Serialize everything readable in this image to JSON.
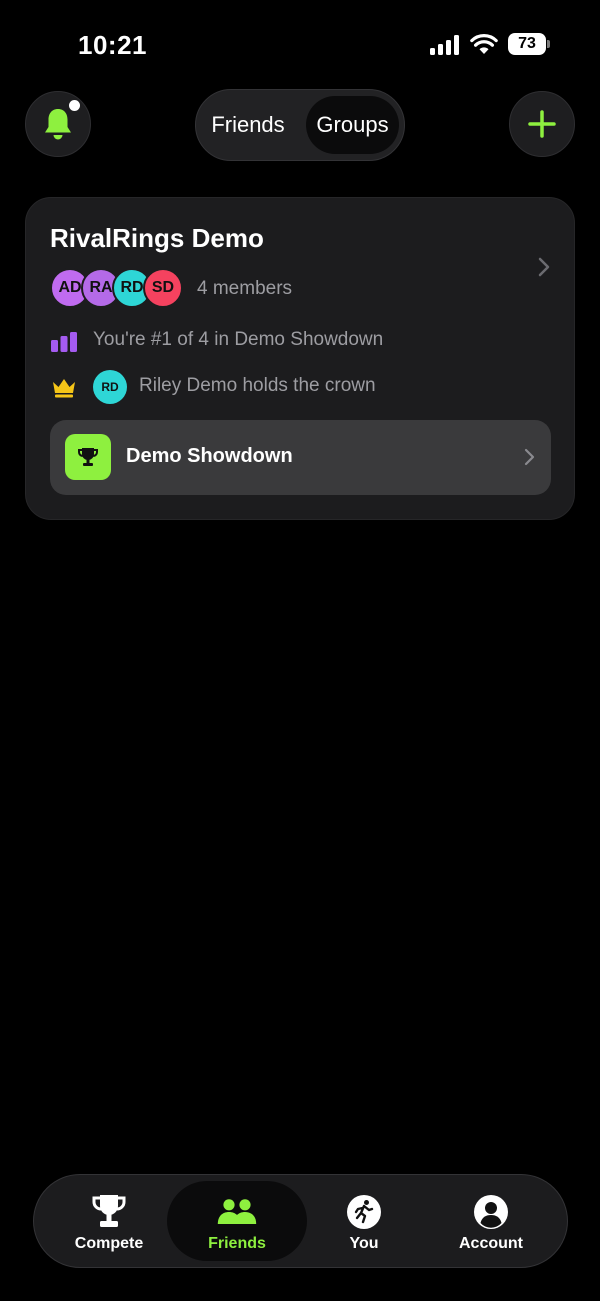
{
  "status_bar": {
    "time": "10:21",
    "battery": "73"
  },
  "header": {
    "segments": [
      {
        "label": "Friends",
        "selected": false
      },
      {
        "label": "Groups",
        "selected": true
      }
    ],
    "bell_has_notification": true
  },
  "group_card": {
    "title": "RivalRings Demo",
    "avatars": [
      {
        "initials": "AD",
        "color": "#c06bf0"
      },
      {
        "initials": "RA",
        "color": "#b46ae8"
      },
      {
        "initials": "RD",
        "color": "#2ed6d6"
      },
      {
        "initials": "SD",
        "color": "#f5425f"
      }
    ],
    "members": "4 members",
    "rank_text": "You're #1 of 4 in Demo Showdown",
    "crown_avatar": "RD",
    "crown_text": "Riley Demo holds the crown",
    "challenge": {
      "name": "Demo Showdown"
    }
  },
  "tab_bar": {
    "tabs": [
      {
        "label": "Compete",
        "icon": "trophy-icon",
        "selected": false
      },
      {
        "label": "Friends",
        "icon": "friends-icon",
        "selected": true
      },
      {
        "label": "You",
        "icon": "runner-icon",
        "selected": false
      },
      {
        "label": "Account",
        "icon": "account-icon",
        "selected": false
      }
    ]
  },
  "colors": {
    "accent": "#8ef03f",
    "background": "#000000",
    "card": "#1c1c1e",
    "secondary_text": "#9d9da2",
    "rank_icon": "#a45bf0",
    "crown": "#f5c518"
  }
}
